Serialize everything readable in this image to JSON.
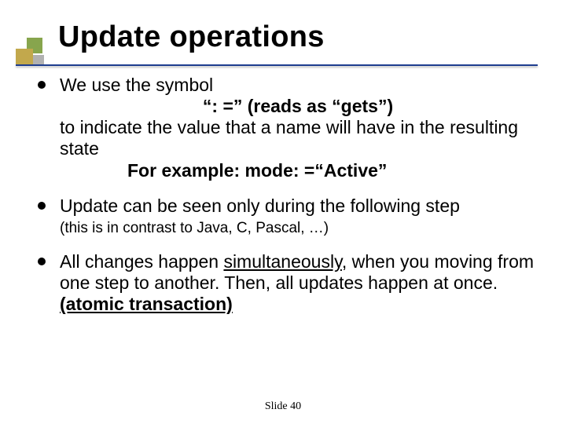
{
  "title": "Update operations",
  "bullet1": {
    "line1": "We use the symbol",
    "symbol": "“: =” (reads as “gets”)",
    "line2": "to indicate the value that a name will have in the resulting state",
    "example_label": "For example: ",
    "example": "mode: =“Active”"
  },
  "bullet2": {
    "text": "Update can be seen only during the following step",
    "note": "(this is in contrast to Java, C, Pascal, …)"
  },
  "bullet3": {
    "pre": "All changes happen ",
    "underlined": "simultaneously",
    "mid": ", when you moving from one step to another. Then, all updates happen at once.",
    "tail": "(atomic transaction)"
  },
  "footer": "Slide  40"
}
